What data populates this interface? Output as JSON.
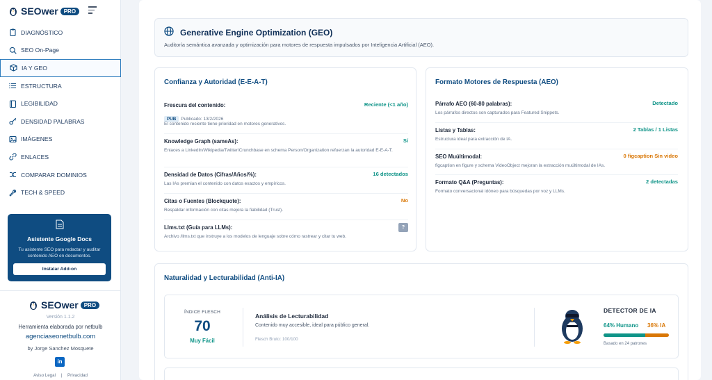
{
  "brand": {
    "name": "SEOwer",
    "badge": "PRO"
  },
  "nav": [
    {
      "label": "DIAGNÓSTICO",
      "icon": "clipboard-icon"
    },
    {
      "label": "SEO On-Page",
      "icon": "search-icon"
    },
    {
      "label": "IA Y GEO",
      "icon": "cube-icon",
      "active": true
    },
    {
      "label": "ESTRUCTURA",
      "icon": "list-icon"
    },
    {
      "label": "LEGIBILIDAD",
      "icon": "book-icon"
    },
    {
      "label": "DENSIDAD PALABRAS",
      "icon": "key-icon"
    },
    {
      "label": "IMÁGENES",
      "icon": "image-icon"
    },
    {
      "label": "ENLACES",
      "icon": "link-icon"
    },
    {
      "label": "COMPARAR DOMINIOS",
      "icon": "shuffle-icon"
    },
    {
      "label": "TECH & SPEED",
      "icon": "wrench-icon"
    }
  ],
  "promo": {
    "title": "Asistente Google Docs",
    "text": "Tu asistente SEO para redactar y auditar contenido AEO en documentos.",
    "button": "Instalar Add-on"
  },
  "footer": {
    "version": "Versión 1.1.2",
    "made_by": "Herramienta elaborada por netbulb",
    "link": "agenciaseonetbulb.com",
    "author": "by Jorge Sanchez Mosquete",
    "linkedin": "in",
    "legal": "Aviso Legal",
    "separator": "|",
    "privacy": "Privacidad"
  },
  "header": {
    "title": "Generative Engine Optimization (GEO)",
    "subtitle": "Auditoría semántica avanzada y optimización para motores de respuesta impulsados por Inteligencia Artificial (AEO)."
  },
  "eeat": {
    "title": "Confianza y Autoridad (E-E-A-T)",
    "rows": [
      {
        "label": "Frescura del contenido:",
        "value": "Reciente (<1 año)",
        "status": "teal",
        "badge": "PUB",
        "date": "Publicado: 13/2/2026",
        "desc": "El contenido reciente tiene prioridad en motores generativos."
      },
      {
        "label": "Knowledge Graph (sameAs):",
        "value": "Sí",
        "status": "teal",
        "desc": "Enlaces a LinkedIn/Wikipedia/Twitter/Crunchbase en schema Person/Organization refuerzan la autoridad E-E-A-T."
      },
      {
        "label": "Densidad de Datos (Cifras/Años/%):",
        "value": "16 detectados",
        "status": "teal",
        "desc": "Las IAs premian el contenido con datos exactos y empíricos."
      },
      {
        "label": "Citas o Fuentes (Blockquote):",
        "value": "No",
        "status": "orange",
        "desc": "Respaldar información con citas mejora la fiabilidad (Trust)."
      },
      {
        "label": "Llms.txt (Guía para LLMs):",
        "value": "?",
        "status": "badge",
        "desc": "Archivo /llms.txt que instruye a los modelos de lenguaje sobre cómo rastrear y citar tu web."
      }
    ]
  },
  "aeo": {
    "title": "Formato Motores de Respuesta (AEO)",
    "rows": [
      {
        "label": "Párrafo AEO (60-80 palabras):",
        "value": "Detectado",
        "status": "teal",
        "desc": "Los párrafos directos son capturados para Featured Snippets."
      },
      {
        "label": "Listas y Tablas:",
        "value": "2 Tablas / 1 Listas",
        "status": "teal",
        "desc": "Estructura ideal para extracción de IA."
      },
      {
        "label": "SEO Muúltimodal:",
        "value": "0 figcaption Sin video",
        "status": "orange",
        "desc": "figcaption en figure y schema VideoObject mejoran la extracción muúltimodal de IAs."
      },
      {
        "label": "Formato Q&A (Preguntas):",
        "value": "2 detectadas",
        "status": "teal",
        "desc": "Formato conversacional idóneo para búsquedas por voz y LLMs."
      }
    ]
  },
  "readability": {
    "title": "Naturalidad y Lecturabilidad (Anti-IA)",
    "flesch_label": "ÍNDICE FLESCH",
    "flesch_value": "70",
    "flesch_word": "Muy Fácil",
    "analysis_title": "Análisis de Lecturabilidad",
    "analysis_text": "Contenido muy accesible, ideal para público general.",
    "raw": "Flesch Bruto: 100/100",
    "detector_title": "DETECTOR DE IA",
    "human": "64% Humano",
    "human_pct": 64,
    "ia": "36% IA",
    "note": "Basado en 24 patrones"
  },
  "colors": {
    "navy": "#0f2f57",
    "brand": "#0f4c81",
    "teal": "#0f9488",
    "orange": "#d97706"
  }
}
